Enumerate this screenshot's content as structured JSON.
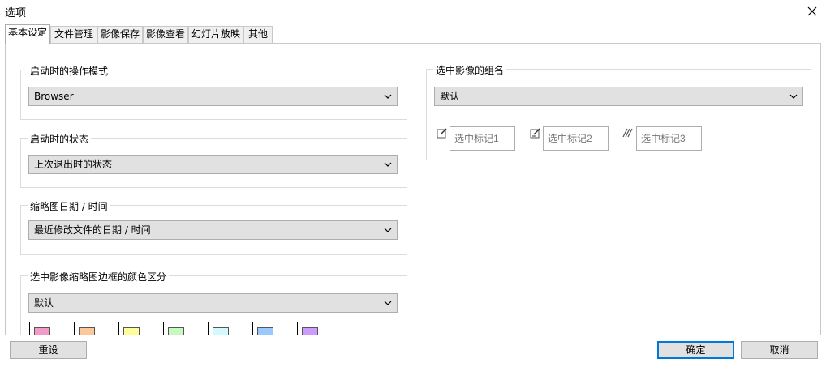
{
  "window": {
    "title": "选项"
  },
  "tabs": [
    {
      "label": "基本设定"
    },
    {
      "label": "文件管理"
    },
    {
      "label": "影像保存"
    },
    {
      "label": "影像查看"
    },
    {
      "label": "幻灯片放映"
    },
    {
      "label": "其他"
    }
  ],
  "groups": {
    "startup_mode": {
      "label": "启动时的操作模式",
      "value": "Browser"
    },
    "startup_state": {
      "label": "启动时的状态",
      "value": "上次退出时的状态"
    },
    "thumb_date": {
      "label": "缩略图日期 / 时间",
      "value": "最近修改文件的日期 / 时间"
    },
    "border_color": {
      "label": "选中影像缩略图边框的颜色区分",
      "value": "默认",
      "swatches": [
        "#f49ac9",
        "#fcc89a",
        "#fdfd9a",
        "#c8f9c3",
        "#d2fafe",
        "#9acafd",
        "#cf9afd"
      ]
    },
    "group_name": {
      "label": "选中影像的组名",
      "value": "默认",
      "marks": [
        {
          "placeholder": "选中标记1",
          "icon": "pencil-icon"
        },
        {
          "placeholder": "选中标记2",
          "icon": "pencil-icon"
        },
        {
          "placeholder": "选中标记3",
          "icon": "hatch-icon"
        }
      ]
    }
  },
  "buttons": {
    "reset": "重设",
    "ok": "确定",
    "cancel": "取消"
  }
}
